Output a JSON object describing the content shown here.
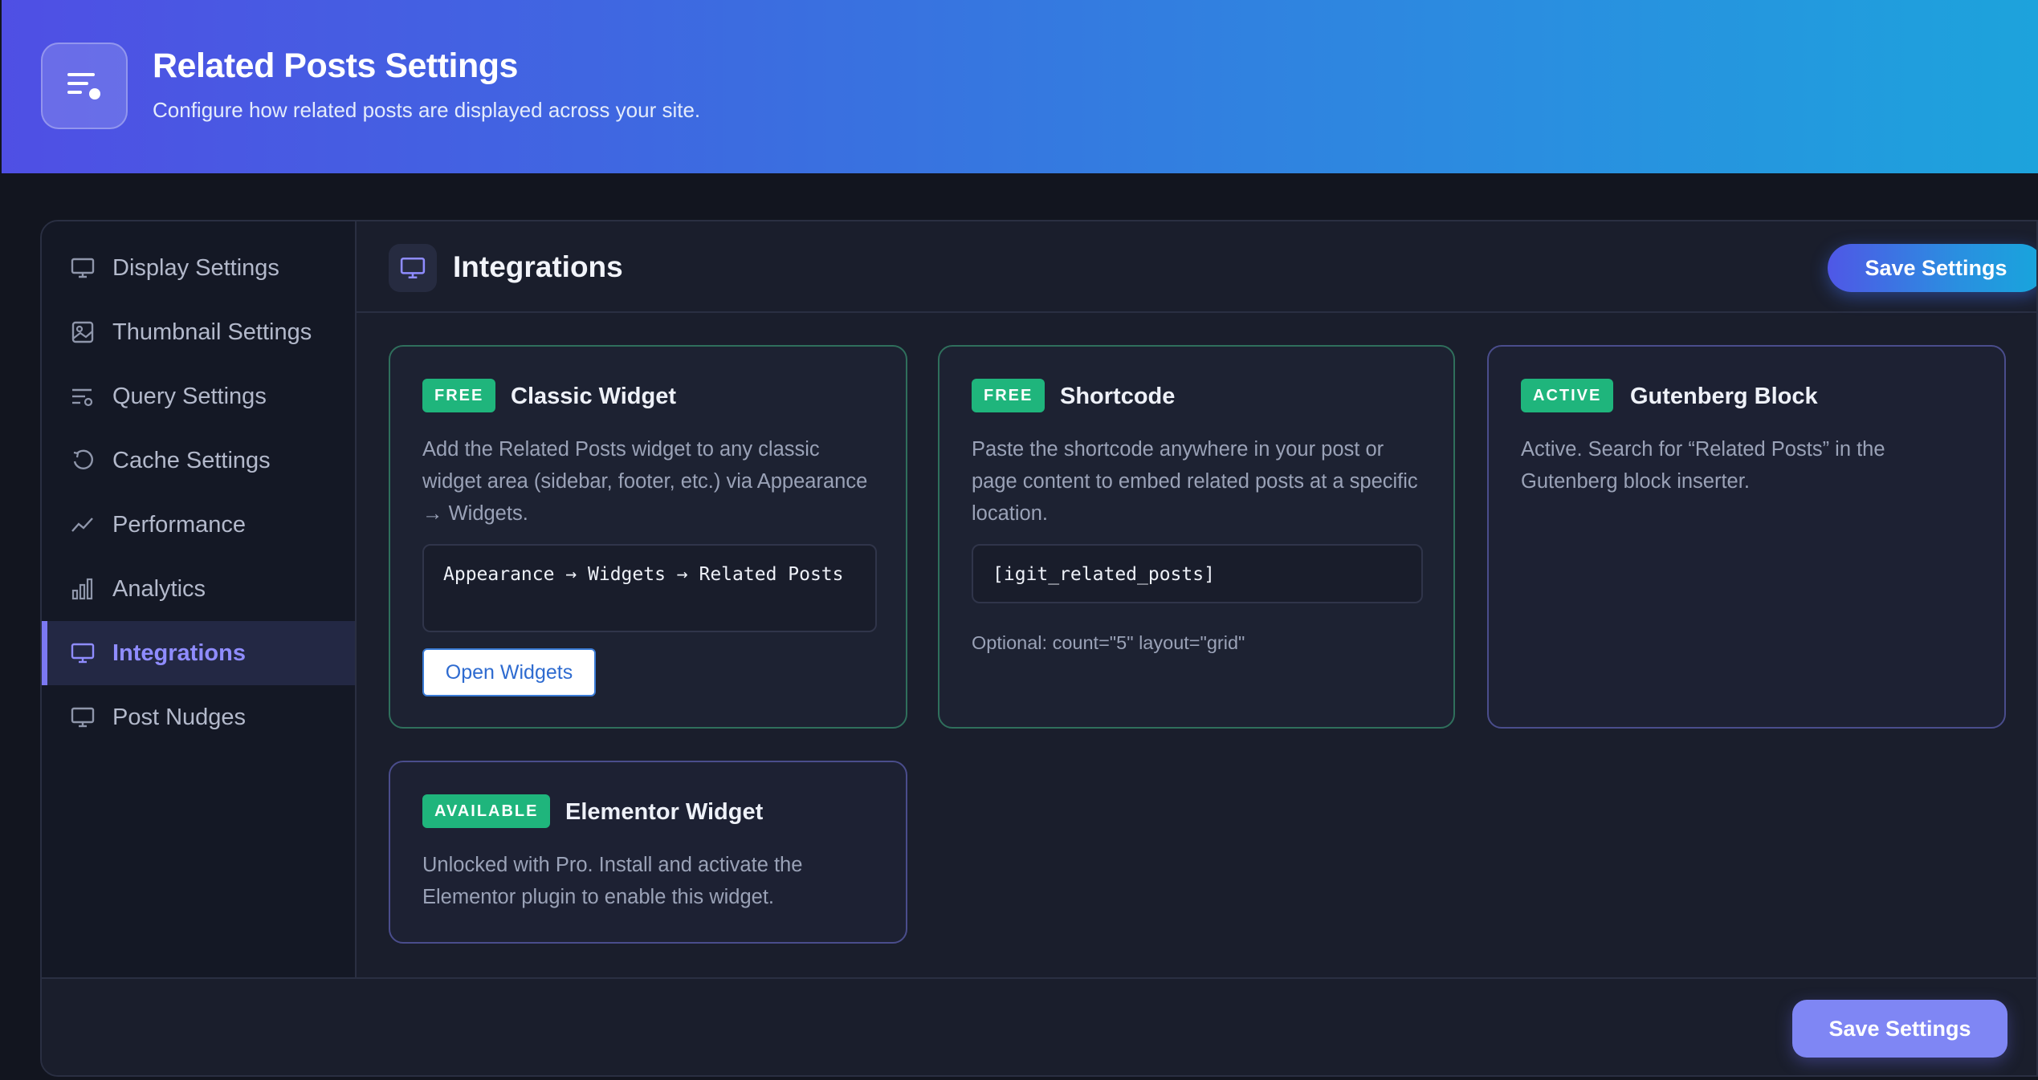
{
  "header": {
    "title": "Related Posts Settings",
    "subtitle": "Configure how related posts are displayed across your site.",
    "icon": "list-settings-icon"
  },
  "sidebar": {
    "items": [
      {
        "label": "Display Settings",
        "icon": "monitor-icon"
      },
      {
        "label": "Thumbnail Settings",
        "icon": "image-icon"
      },
      {
        "label": "Query Settings",
        "icon": "query-filter-icon"
      },
      {
        "label": "Cache Settings",
        "icon": "refresh-icon"
      },
      {
        "label": "Performance",
        "icon": "trend-line-icon"
      },
      {
        "label": "Analytics",
        "icon": "bar-chart-icon"
      },
      {
        "label": "Integrations",
        "icon": "monitor-icon",
        "active": true
      },
      {
        "label": "Post Nudges",
        "icon": "monitor-icon"
      }
    ]
  },
  "main": {
    "section_title": "Integrations",
    "save_label": "Save Settings",
    "cards": [
      {
        "badge": "FREE",
        "title": "Classic Widget",
        "description": "Add the Related Posts widget to any classic widget area (sidebar, footer, etc.) via Appearance → Widgets.",
        "code": "Appearance → Widgets → Related Posts",
        "button": "Open Widgets"
      },
      {
        "badge": "FREE",
        "title": "Shortcode",
        "description": "Paste the shortcode anywhere in your post or page content to embed related posts at a specific location.",
        "code": "[igit_related_posts]",
        "note": "Optional: count=\"5\" layout=\"grid\""
      },
      {
        "badge": "ACTIVE",
        "title": "Gutenberg Block",
        "description": "Active. Search for “Related Posts” in the Gutenberg block inserter."
      },
      {
        "badge": "AVAILABLE",
        "title": "Elementor Widget",
        "description": "Unlocked with Pro. Install and activate the Elementor plugin to enable this widget."
      }
    ]
  },
  "footer": {
    "save_label": "Save Settings"
  },
  "colors": {
    "accent": "#7b78f2",
    "badge_green": "#1fb57c",
    "background": "#12151f"
  }
}
